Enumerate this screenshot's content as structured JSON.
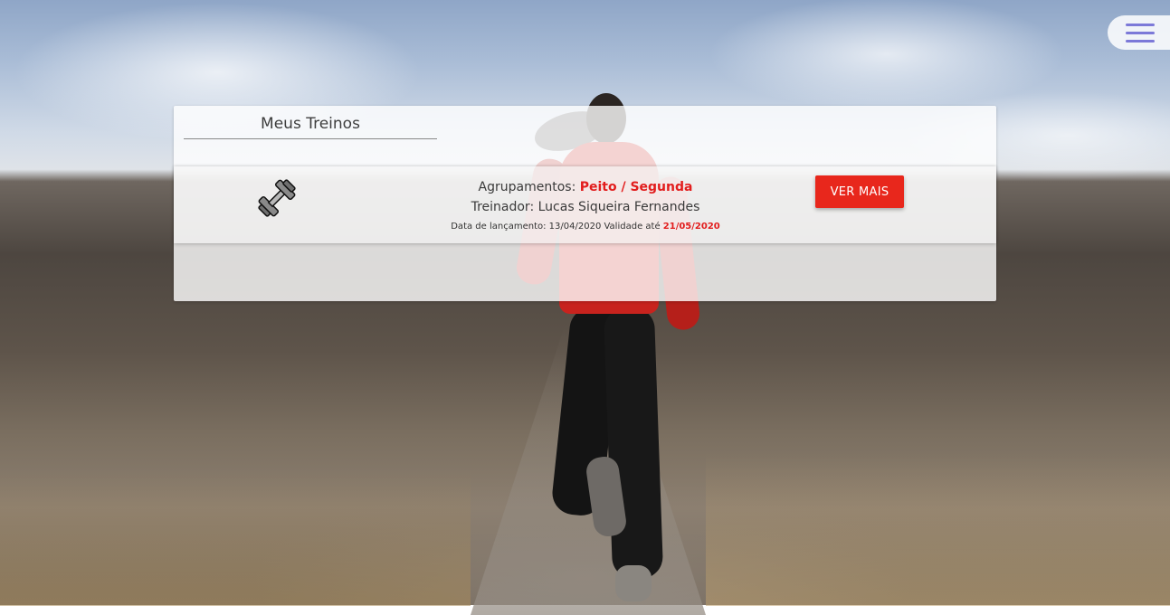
{
  "menu": {
    "icon": "hamburger-menu-icon",
    "color": "#7c79d8"
  },
  "card": {
    "title": "Meus Treinos"
  },
  "treinos": [
    {
      "icon": "dumbbell-icon",
      "grouping_label": "Agrupamentos: ",
      "grouping_value": "Peito / Segunda",
      "trainer_label": "Treinador: ",
      "trainer_name": "Lucas Siqueira Fernandes",
      "release_label": "Data de lançamento: ",
      "release_date": "13/04/2020",
      "validity_label": " Validade até ",
      "validity_date": "21/05/2020",
      "button_label": "VER MAIS"
    }
  ],
  "colors": {
    "accent": "#e21d1d",
    "button": "#e8271c"
  }
}
